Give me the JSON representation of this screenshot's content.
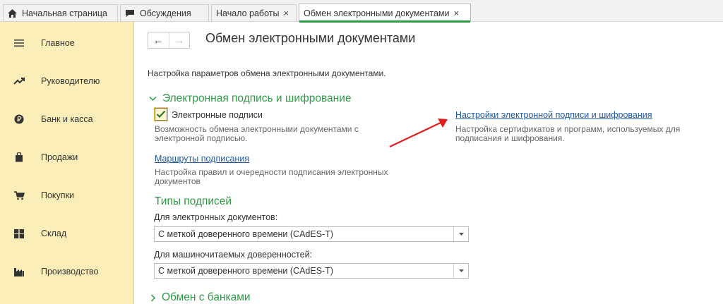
{
  "tabs": [
    {
      "label": "Начальная страница",
      "has_close": false
    },
    {
      "label": "Обсуждения",
      "has_close": false
    },
    {
      "label": "Начало работы",
      "has_close": true
    },
    {
      "label": "Обмен электронными документами",
      "has_close": true
    }
  ],
  "tab_close_glyph": "×",
  "sidebar": {
    "items": [
      {
        "label": "Главное",
        "icon": "menu-icon"
      },
      {
        "label": "Руководителю",
        "icon": "trend-icon"
      },
      {
        "label": "Банк и касса",
        "icon": "ruble-icon"
      },
      {
        "label": "Продажи",
        "icon": "shopping-bag-icon"
      },
      {
        "label": "Покупки",
        "icon": "cart-icon"
      },
      {
        "label": "Склад",
        "icon": "warehouse-icon"
      },
      {
        "label": "Производство",
        "icon": "factory-icon"
      }
    ]
  },
  "nav": {
    "back_glyph": "←",
    "forward_glyph": "→"
  },
  "page": {
    "title": "Обмен электронными документами",
    "description": "Настройка параметров обмена электронными документами."
  },
  "section_signature": {
    "title": "Электронная подпись и шифрование",
    "checkbox_label": "Электронные подписи",
    "checkbox_checked": true,
    "checkbox_help_1": "Возможность обмена электронными документами с",
    "checkbox_help_2": "электронной подписью.",
    "settings_link": "Настройки электронной подписи и шифрования",
    "settings_help_1": "Настройка сертификатов и программ, используемых для",
    "settings_help_2": "подписания и шифрования.",
    "routes_link": "Маршруты подписания",
    "routes_help_1": "Настройка правил и очередности подписания электронных",
    "routes_help_2": "документов"
  },
  "signature_types": {
    "title": "Типы подписей",
    "field1_label": "Для электронных документов:",
    "field1_value": "С меткой доверенного времени (CAdES-T)",
    "field2_label": "Для машиночитаемых доверенностей:",
    "field2_value": "С меткой доверенного времени (CAdES-T)"
  },
  "section_banks": {
    "title": "Обмен с банками"
  },
  "colors": {
    "accent_green": "#2e9a45",
    "link_blue": "#1f5aa6",
    "sidebar_bg": "#fbeeb8",
    "annotation_red": "#e02020"
  }
}
